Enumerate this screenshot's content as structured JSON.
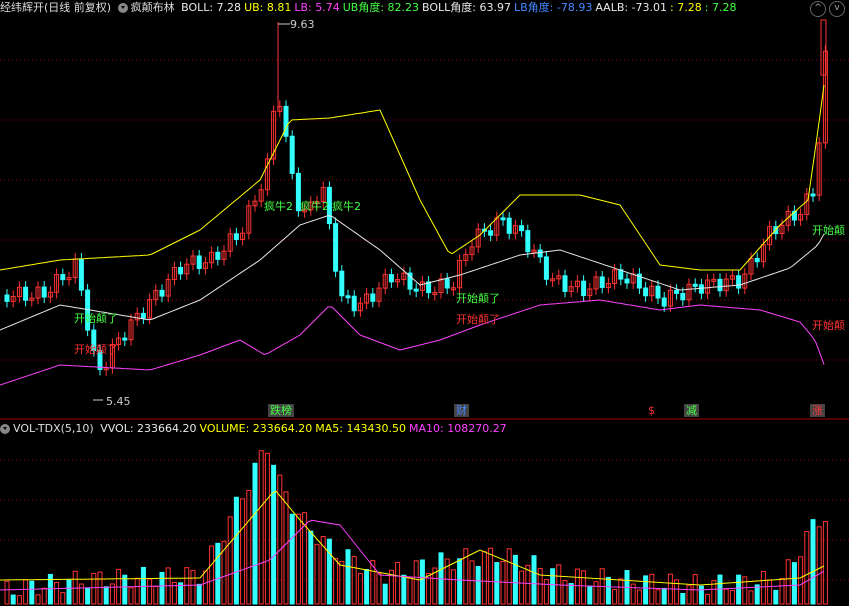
{
  "top_header": {
    "stock": "经纬辉开(日线 前复权)",
    "indicator": "疯颠布林",
    "items": [
      {
        "label": "BOLL: 7.28",
        "color": "#e8e8e8"
      },
      {
        "label": "UB: 8.81",
        "color": "#ffff00"
      },
      {
        "label": "LB: 5.74",
        "color": "#ff44ff"
      },
      {
        "label": "UB角度: 82.23",
        "color": "#44ff44"
      },
      {
        "label": "BOLL角度: 63.97",
        "color": "#e8e8e8"
      },
      {
        "label": "LB角度: -78.93",
        "color": "#4488ff"
      },
      {
        "label": "AALB: -73.01",
        "color": "#e8e8e8"
      },
      {
        "label": ": 7.28",
        "color": "#ffff00"
      },
      {
        "label": ": 7.28",
        "color": "#44ff44"
      }
    ]
  },
  "bottom_header": {
    "indicator": "VOL-TDX(5,10)",
    "items": [
      {
        "label": "VVOL: 233664.20",
        "color": "#e8e8e8"
      },
      {
        "label": "VOLUME: 233664.20",
        "color": "#ffff00"
      },
      {
        "label": "MA5: 143430.50",
        "color": "#ffff00"
      },
      {
        "label": "MA10: 108270.27",
        "color": "#ff44ff"
      }
    ]
  },
  "window_controls": [
    "^",
    "v"
  ],
  "annotations": {
    "high_label": "9.63",
    "low_label": "5.45",
    "signal_green_1": "开始颠了",
    "signal_red_1": "开始颠了",
    "signal_green_2": "开始颠了",
    "signal_red_2": "开始颠了",
    "signal_green_right": "开始颠",
    "signal_red_right": "开始颠",
    "bull_1": "疯牛2",
    "bull_2": "疯牛2",
    "bull_3": "疯牛2"
  },
  "event_tags": [
    {
      "text": "跌榜",
      "color": "#44ff44"
    },
    {
      "text": "财",
      "color": "#4488ff"
    },
    {
      "text": "$",
      "color": "#ff3333"
    },
    {
      "text": "减",
      "color": "#44ff44"
    },
    {
      "text": "涨",
      "color": "#ff3333"
    }
  ],
  "colors": {
    "up": "#ff3333",
    "down": "#33ffff",
    "ub": "#ffff00",
    "boll": "#e8e8e8",
    "lb": "#ff44ff",
    "grid": "#8b0000"
  }
}
